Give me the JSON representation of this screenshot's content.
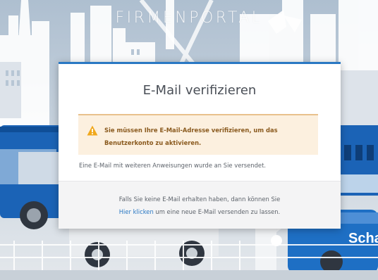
{
  "portal": {
    "title": "FIRMENPORTAL",
    "bus_sign": "Scha"
  },
  "dialog": {
    "title": "E-Mail verifizieren",
    "alert": {
      "icon": "warning-triangle-icon",
      "message": "Sie müssen Ihre E-Mail-Adresse verifizieren, um das Benutzerkonto zu aktivieren."
    },
    "info": "Eine E-Mail mit weiteren Anweisungen wurde an Sie versendet.",
    "footer": {
      "line1": "Falls Sie keine E-Mail erhalten haben, dann können Sie",
      "link_label": "Hier klicken",
      "line2_rest": " um eine neue E-Mail versenden zu lassen."
    }
  },
  "colors": {
    "accent": "#2a78c3",
    "alert_background": "#fcf0df",
    "alert_text": "#8a5a1e",
    "warning_icon": "#f0a81c",
    "bus_blue": "#1b63b6"
  }
}
